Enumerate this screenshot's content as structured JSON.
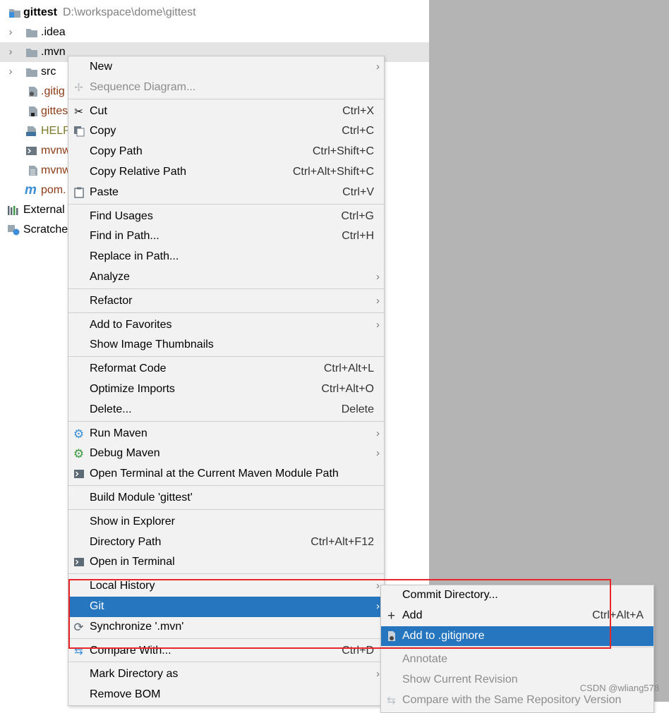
{
  "tree": {
    "root": {
      "name": "gittest",
      "path": "D:\\workspace\\dome\\gittest"
    },
    "rows": [
      {
        "label": ".idea"
      },
      {
        "label": ".mvn"
      },
      {
        "label": "src"
      },
      {
        "label": ".gitig"
      },
      {
        "label": "gittes"
      },
      {
        "label": "HELP"
      },
      {
        "label": "mvnw"
      },
      {
        "label": "mvnw"
      },
      {
        "label": "pom."
      },
      {
        "label": "External"
      },
      {
        "label": "Scratche"
      }
    ]
  },
  "context_menu": {
    "items": [
      {
        "label": "New",
        "shortcut": ""
      },
      {
        "label": "Sequence Diagram...",
        "shortcut": ""
      },
      {
        "label": "Cut",
        "shortcut": "Ctrl+X"
      },
      {
        "label": "Copy",
        "shortcut": "Ctrl+C"
      },
      {
        "label": "Copy Path",
        "shortcut": "Ctrl+Shift+C"
      },
      {
        "label": "Copy Relative Path",
        "shortcut": "Ctrl+Alt+Shift+C"
      },
      {
        "label": "Paste",
        "shortcut": "Ctrl+V"
      },
      {
        "label": "Find Usages",
        "shortcut": "Ctrl+G"
      },
      {
        "label": "Find in Path...",
        "shortcut": "Ctrl+H"
      },
      {
        "label": "Replace in Path...",
        "shortcut": ""
      },
      {
        "label": "Analyze",
        "shortcut": ""
      },
      {
        "label": "Refactor",
        "shortcut": ""
      },
      {
        "label": "Add to Favorites",
        "shortcut": ""
      },
      {
        "label": "Show Image Thumbnails",
        "shortcut": ""
      },
      {
        "label": "Reformat Code",
        "shortcut": "Ctrl+Alt+L"
      },
      {
        "label": "Optimize Imports",
        "shortcut": "Ctrl+Alt+O"
      },
      {
        "label": "Delete...",
        "shortcut": "Delete"
      },
      {
        "label": "Run Maven",
        "shortcut": ""
      },
      {
        "label": "Debug Maven",
        "shortcut": ""
      },
      {
        "label": "Open Terminal at the Current Maven Module Path",
        "shortcut": ""
      },
      {
        "label": "Build Module 'gittest'",
        "shortcut": ""
      },
      {
        "label": "Show in Explorer",
        "shortcut": ""
      },
      {
        "label": "Directory Path",
        "shortcut": "Ctrl+Alt+F12"
      },
      {
        "label": "Open in Terminal",
        "shortcut": ""
      },
      {
        "label": "Local History",
        "shortcut": ""
      },
      {
        "label": "Git",
        "shortcut": ""
      },
      {
        "label": "Synchronize '.mvn'",
        "shortcut": ""
      },
      {
        "label": "Compare With...",
        "shortcut": "Ctrl+D"
      },
      {
        "label": "Mark Directory as",
        "shortcut": ""
      },
      {
        "label": "Remove BOM",
        "shortcut": ""
      }
    ]
  },
  "git_submenu": {
    "items": [
      {
        "label": "Commit Directory...",
        "shortcut": ""
      },
      {
        "label": "Add",
        "shortcut": "Ctrl+Alt+A"
      },
      {
        "label": "Add to .gitignore",
        "shortcut": ""
      },
      {
        "label": "Annotate",
        "shortcut": ""
      },
      {
        "label": "Show Current Revision",
        "shortcut": ""
      },
      {
        "label": "Compare with the Same Repository Version",
        "shortcut": ""
      }
    ]
  },
  "watermark": "CSDN @wliang578",
  "colors": {
    "selection": "#2675bf",
    "highlight_box": "#e8262a",
    "menu_bg": "#f2f2f2",
    "folder": "#9aa7b0"
  }
}
